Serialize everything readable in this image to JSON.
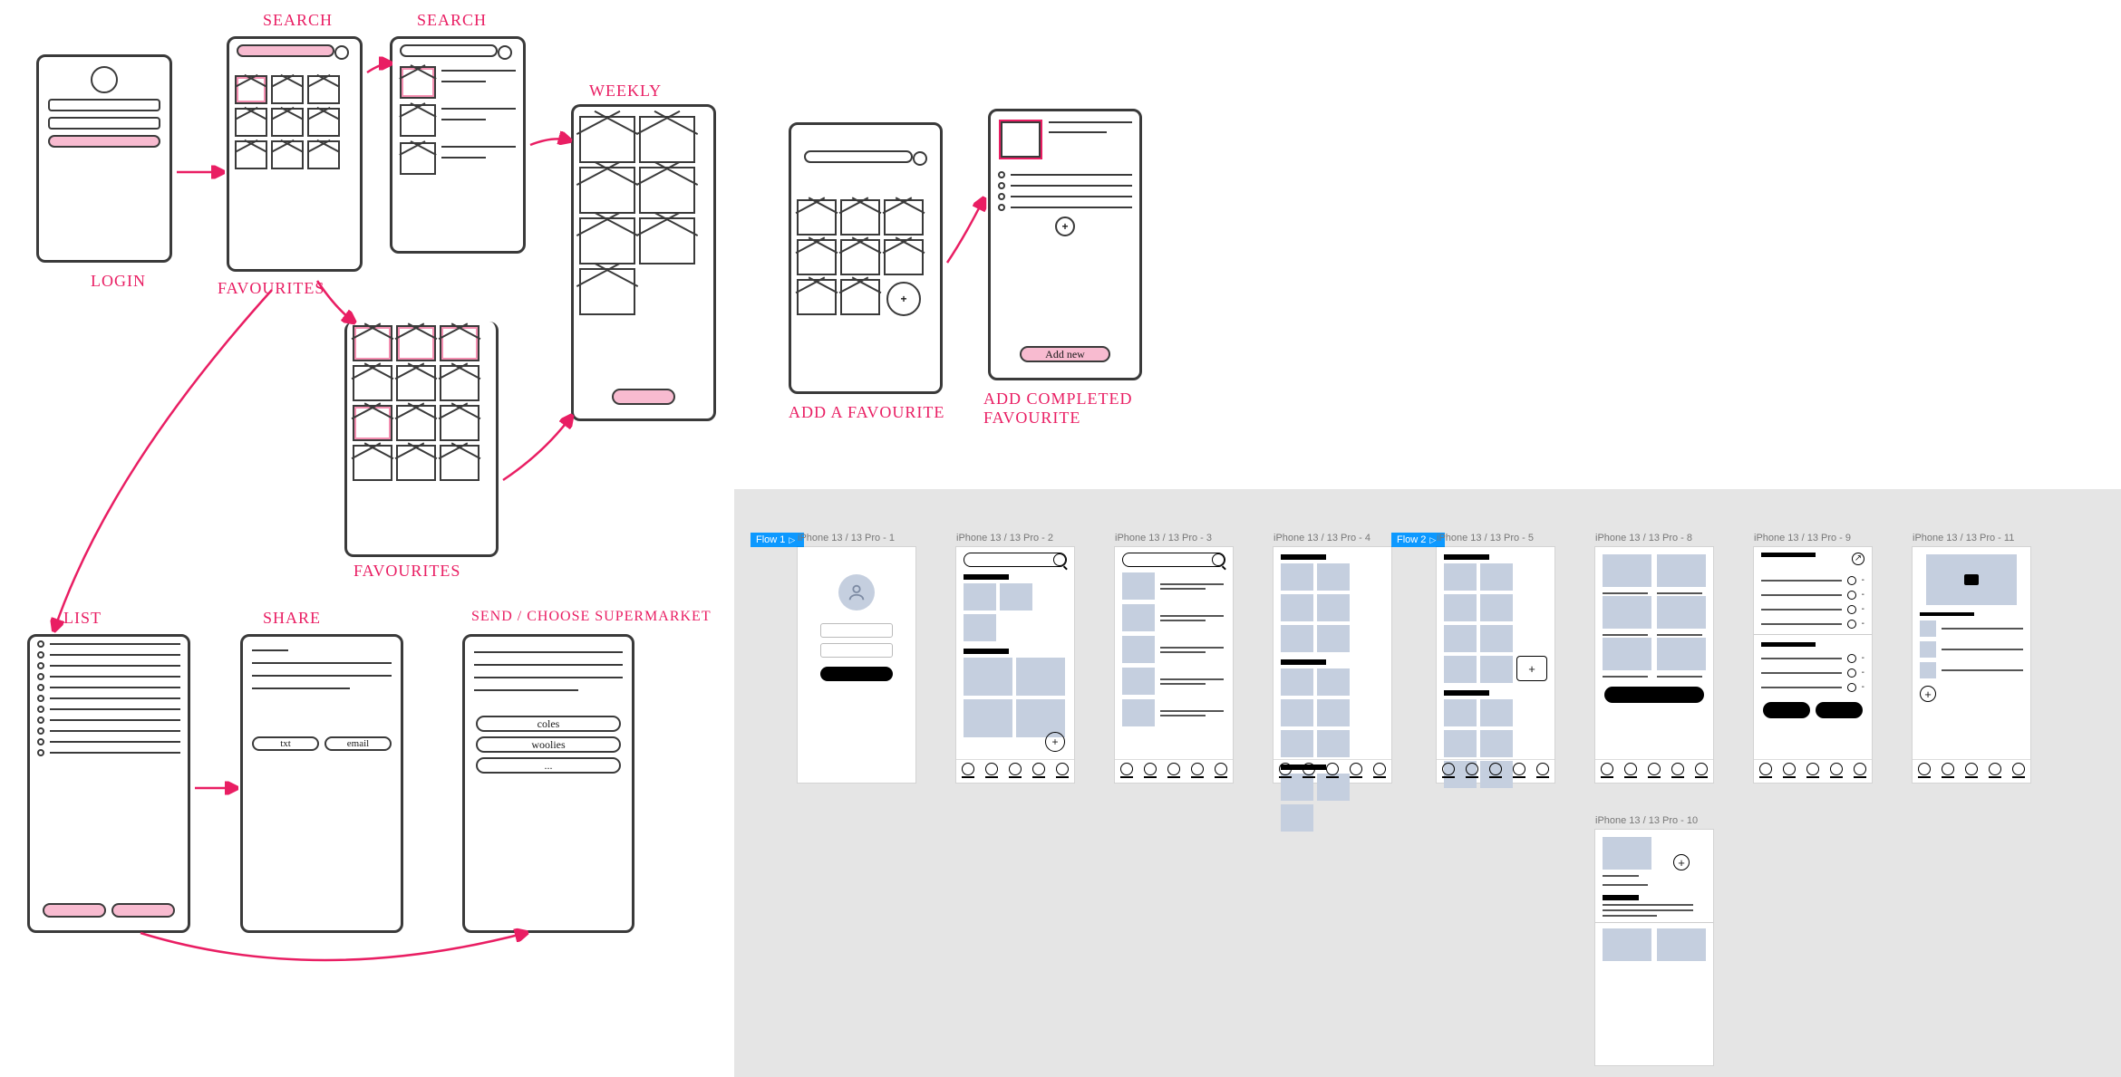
{
  "sketches": {
    "login": {
      "label": "LOGIN"
    },
    "search1": {
      "label": "SEARCH"
    },
    "search2": {
      "label": "SEARCH"
    },
    "weekly": {
      "label": "WEEKLY"
    },
    "favourites": {
      "label": "FAVOURITES"
    },
    "favourites2": {
      "label": "FAVOURITES"
    },
    "add_fav": {
      "label": "ADD A FAVOURITE"
    },
    "add_completed": {
      "label": "ADD COMPLETED FAVOURITE",
      "button": "Add new"
    },
    "list": {
      "label": "LIST"
    },
    "share": {
      "label": "SHARE",
      "options": [
        "txt",
        "email"
      ]
    },
    "send": {
      "label": "SEND / CHOOSE SUPERMARKET",
      "options": [
        "coles",
        "woolies",
        "..."
      ]
    }
  },
  "figma": {
    "flows": [
      "Flow 1",
      "Flow 2"
    ],
    "frames": [
      {
        "name": "iPhone 13 / 13 Pro - 1"
      },
      {
        "name": "iPhone 13 / 13 Pro - 2"
      },
      {
        "name": "iPhone 13 / 13 Pro - 3"
      },
      {
        "name": "iPhone 13 / 13 Pro - 4"
      },
      {
        "name": "iPhone 13 / 13 Pro - 5"
      },
      {
        "name": "iPhone 13 / 13 Pro - 8"
      },
      {
        "name": "iPhone 13 / 13 Pro - 9"
      },
      {
        "name": "iPhone 13 / 13 Pro - 11"
      },
      {
        "name": "iPhone 13 / 13 Pro - 10"
      }
    ]
  }
}
